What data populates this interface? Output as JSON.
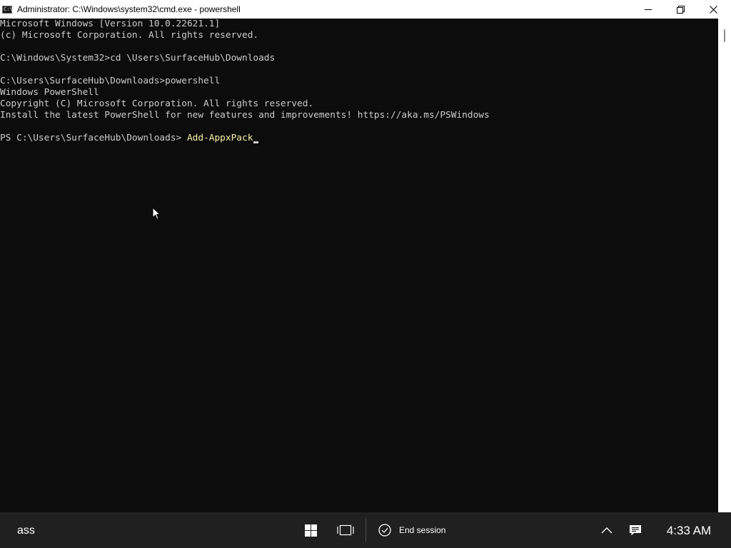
{
  "window": {
    "title": "Administrator: C:\\Windows\\system32\\cmd.exe - powershell",
    "icon": "cmd-icon",
    "icon_prompt": "C:\\",
    "controls": [
      "minimize-icon",
      "restore-icon",
      "close-icon"
    ]
  },
  "console": {
    "lines": [
      "Microsoft Windows [Version 10.0.22621.1]",
      "(c) Microsoft Corporation. All rights reserved.",
      "",
      "C:\\Windows\\System32>cd \\Users\\SurfaceHub\\Downloads",
      "",
      "C:\\Users\\SurfaceHub\\Downloads>powershell",
      "Windows PowerShell",
      "Copyright (C) Microsoft Corporation. All rights reserved.",
      "Install the latest PowerShell for new features and improvements! https://aka.ms/PSWindows",
      ""
    ],
    "prompt": "PS C:\\Users\\SurfaceHub\\Downloads> ",
    "current_input": "Add-AppxPack",
    "colors": {
      "background": "#0c0c0c",
      "text": "#cccccc",
      "command": "#f9f1a5"
    }
  },
  "taskbar": {
    "search_text": "ass",
    "start_icon": "windows-start-icon",
    "task_view_icon": "task-view-icon",
    "end_session_icon": "check-circle-icon",
    "end_session_label": "End session",
    "tray_chevron_icon": "chevron-up-icon",
    "notification_icon": "notification-icon",
    "clock": "4:33 AM"
  }
}
